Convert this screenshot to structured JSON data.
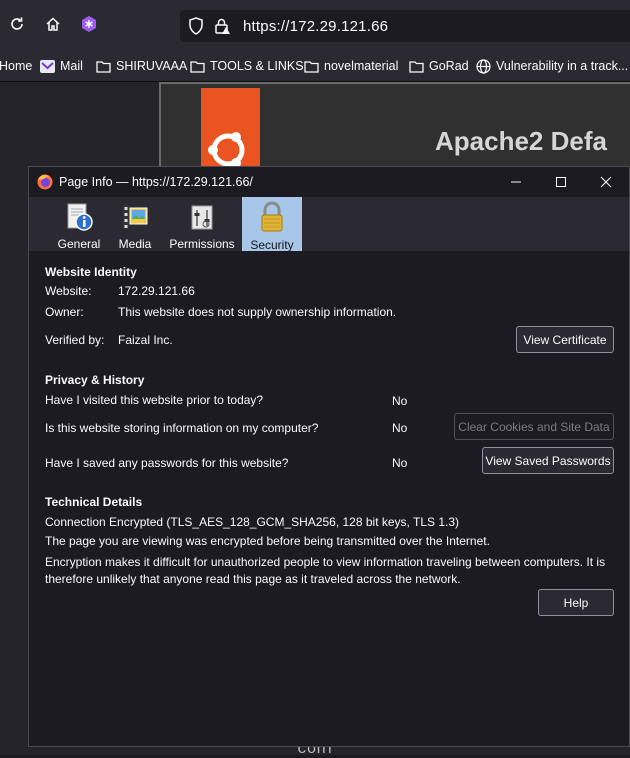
{
  "browser": {
    "url": "https://172.29.121.66",
    "bookmarks": [
      {
        "label": "Home"
      },
      {
        "label": "Mail"
      },
      {
        "label": "SHIRUVAAA"
      },
      {
        "label": "TOOLS & LINKS"
      },
      {
        "label": "novelmaterial"
      },
      {
        "label": "GoRad"
      },
      {
        "label": "Vulnerability in a track..."
      }
    ]
  },
  "background_page": {
    "title": "Apache2 Defa",
    "bottom_fragment": "* conf"
  },
  "dialog": {
    "title": "Page Info — https://172.29.121.66/",
    "tabs": [
      {
        "label": "General",
        "icon": "info-icon"
      },
      {
        "label": "Media",
        "icon": "media-icon"
      },
      {
        "label": "Permissions",
        "icon": "permissions-icon"
      },
      {
        "label": "Security",
        "icon": "lock-icon"
      }
    ],
    "identity": {
      "heading": "Website Identity",
      "website_label": "Website:",
      "website_value": "172.29.121.66",
      "owner_label": "Owner:",
      "owner_value": "This website does not supply ownership information.",
      "verified_label": "Verified by:",
      "verified_value": "Faizal Inc.",
      "view_cert_button": "View Certificate"
    },
    "privacy": {
      "heading": "Privacy & History",
      "q1": "Have I visited this website prior to today?",
      "a1": "No",
      "q2": "Is this website storing information on my computer?",
      "a2": "No",
      "clear_button": "Clear Cookies and Site Data",
      "q3": "Have I saved any passwords for this website?",
      "a3": "No",
      "view_passwords_button": "View Saved Passwords"
    },
    "technical": {
      "heading": "Technical Details",
      "connection": "Connection Encrypted (TLS_AES_128_GCM_SHA256, 128 bit keys, TLS 1.3)",
      "line2": "The page you are viewing was encrypted before being transmitted over the Internet.",
      "line3": "Encryption makes it difficult for unauthorized people to view information traveling between computers. It is therefore unlikely that anyone read this page as it traveled across the network."
    },
    "help_button": "Help"
  }
}
